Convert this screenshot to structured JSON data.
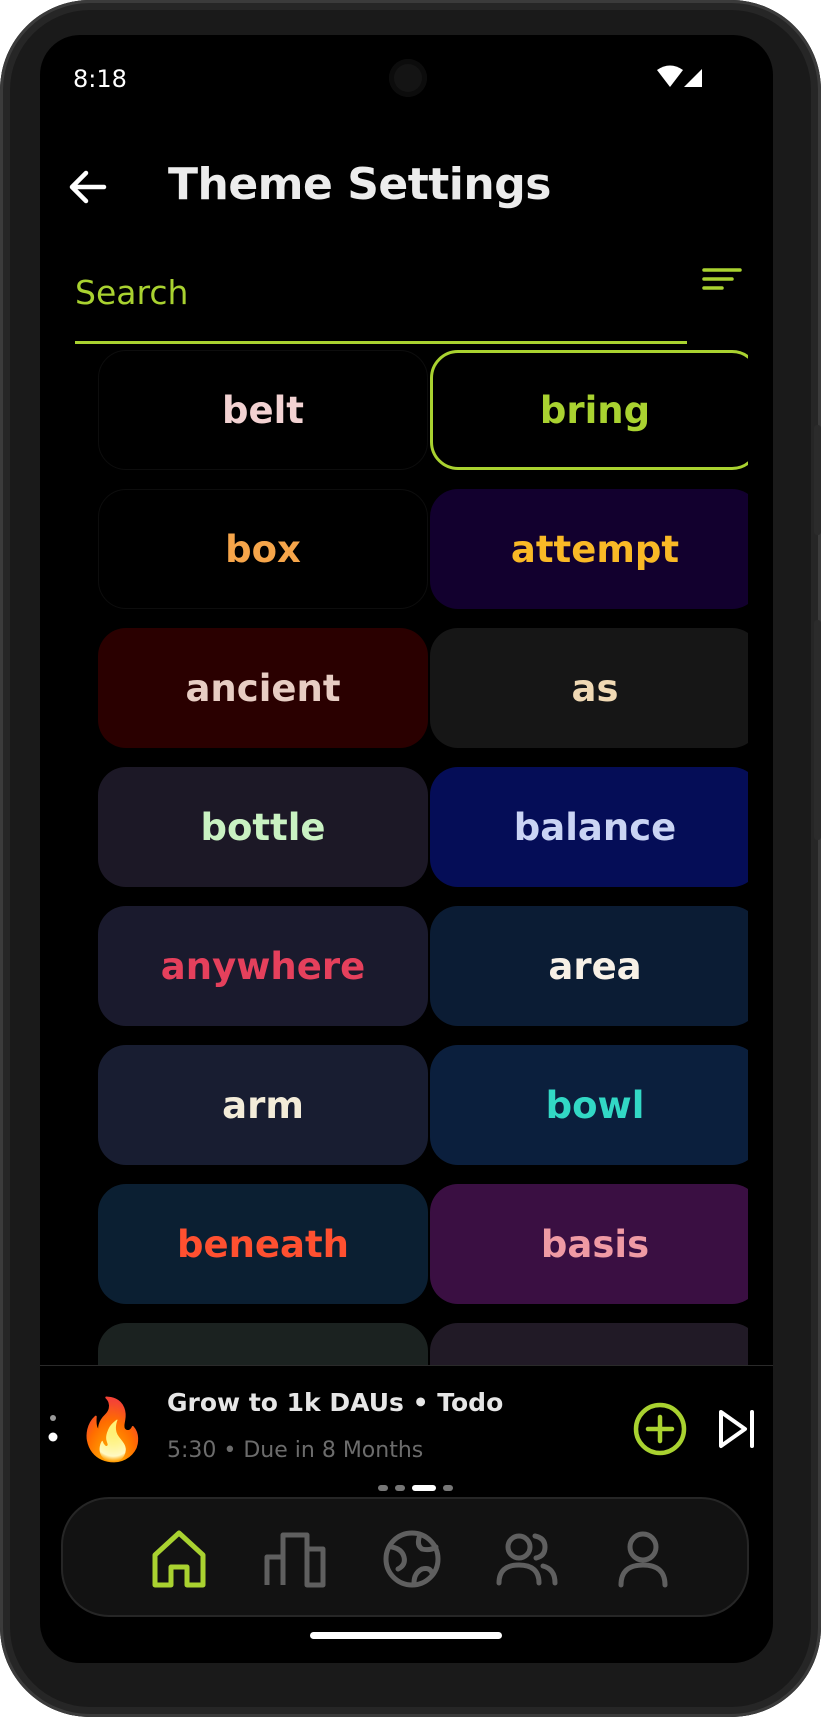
{
  "status_bar": {
    "time": "8:18"
  },
  "header": {
    "title": "Theme Settings"
  },
  "search": {
    "placeholder": "Search"
  },
  "themes": [
    {
      "label": "belt",
      "bg": "#000000",
      "fg": "#f2d2d2",
      "border": "#0d0d0d",
      "selected": false
    },
    {
      "label": "bring",
      "bg": "#000000",
      "fg": "#a9d230",
      "border": "#a9d230",
      "selected": true
    },
    {
      "label": "box",
      "bg": "#000000",
      "fg": "#f6a54a",
      "border": "#0d0d0d",
      "selected": false
    },
    {
      "label": "attempt",
      "bg": "#12002e",
      "fg": "#f9b926",
      "selected": false
    },
    {
      "label": "ancient",
      "bg": "#2a0000",
      "fg": "#e7cdc3",
      "selected": false
    },
    {
      "label": "as",
      "bg": "#161616",
      "fg": "#f0d9b4",
      "selected": false
    },
    {
      "label": "bottle",
      "bg": "#1c1826",
      "fg": "#c9f2c2",
      "selected": false
    },
    {
      "label": "balance",
      "bg": "#050d57",
      "fg": "#cad4f4",
      "selected": false
    },
    {
      "label": "anywhere",
      "bg": "#1a1a2d",
      "fg": "#e5405c",
      "selected": false
    },
    {
      "label": "area",
      "bg": "#0b1c34",
      "fg": "#f7f0e6",
      "selected": false
    },
    {
      "label": "arm",
      "bg": "#181d31",
      "fg": "#f3ecd9",
      "selected": false
    },
    {
      "label": "bowl",
      "bg": "#0b1f3d",
      "fg": "#32d8c5",
      "selected": false
    },
    {
      "label": "beneath",
      "bg": "#0b1f32",
      "fg": "#ff5030",
      "selected": false
    },
    {
      "label": "basis",
      "bg": "#3a0f42",
      "fg": "#ef9aa4",
      "selected": false
    },
    {
      "label": "",
      "bg": "#1b2220",
      "fg": "#ffffff",
      "selected": false
    },
    {
      "label": "",
      "bg": "#211a26",
      "fg": "#ffffff",
      "selected": false
    }
  ],
  "mini_player": {
    "emoji": "🔥",
    "title": "Grow to 1k DAUs • Todo",
    "subtitle": "5:30 • Due in 8 Months"
  },
  "bottom_nav": {
    "items": [
      {
        "icon": "home-icon",
        "active": true
      },
      {
        "icon": "leaderboard-icon",
        "active": false
      },
      {
        "icon": "globe-icon",
        "active": false
      },
      {
        "icon": "friends-icon",
        "active": false
      },
      {
        "icon": "profile-icon",
        "active": false
      }
    ]
  },
  "colors": {
    "accent": "#a9d230",
    "background": "#000000",
    "inactive_icon": "#5f5f5f"
  }
}
